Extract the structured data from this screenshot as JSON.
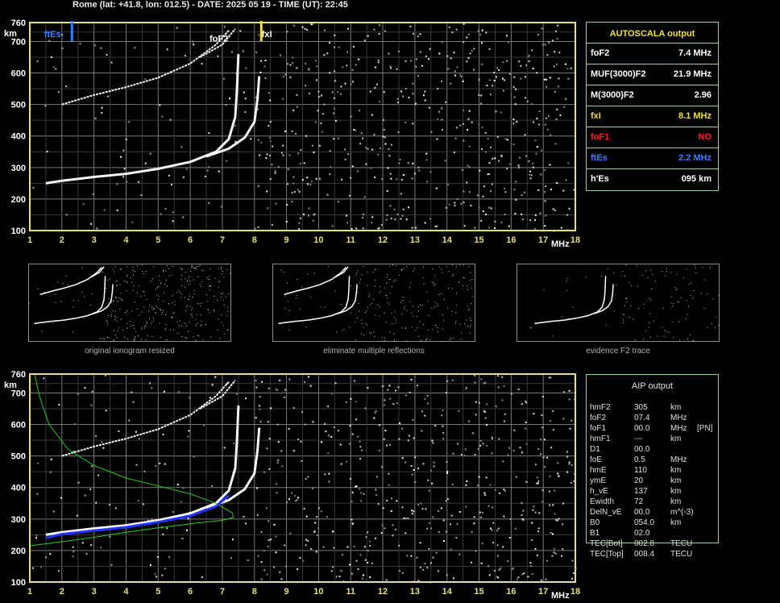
{
  "header": {
    "title": "Rome (lat: +41.8, lon: 012.5) - DATE: 2025 05 19 - TIME (UT): 22:45"
  },
  "colors": {
    "axis": "#e8e07a",
    "grid": "#7a7a7a",
    "panel_border": "#8fd68f",
    "ftes": "#3a7fff",
    "fxi": "#f0e040",
    "fof1": "#ff2020",
    "profile_green": "#22cc22",
    "profile_blue": "#2233ff"
  },
  "chart_data": [
    {
      "type": "scatter",
      "name_id": "main-ionogram",
      "xlabel": "MHz",
      "ylabel": "km",
      "xlim": [
        1,
        18
      ],
      "ylim": [
        100,
        760
      ],
      "x_ticks": [
        "1",
        "2",
        "3",
        "4",
        "5",
        "6",
        "7",
        "8",
        "9",
        "10",
        "11",
        "12",
        "13",
        "14",
        "15",
        "16",
        "17",
        "18"
      ],
      "y_ticks": [
        "100",
        "200",
        "300",
        "400",
        "500",
        "600",
        "700",
        "760"
      ],
      "grid": true,
      "markers": [
        {
          "label": "ftEs",
          "x": 2.2,
          "color": "#3a7fff"
        },
        {
          "label": "fxI",
          "x": 8.1,
          "color": "#f0e040"
        }
      ],
      "annotations": [
        {
          "label": "foF2",
          "x": 6.6,
          "y": 710
        }
      ],
      "traces": {
        "o_first_hop": [
          [
            1.5,
            250
          ],
          [
            2,
            258
          ],
          [
            3,
            270
          ],
          [
            4,
            280
          ],
          [
            5,
            296
          ],
          [
            6,
            318
          ],
          [
            6.8,
            350
          ],
          [
            7.2,
            390
          ],
          [
            7.4,
            460
          ],
          [
            7.45,
            540
          ],
          [
            7.5,
            660
          ]
        ],
        "x_first_hop": [
          [
            6.5,
            335
          ],
          [
            7.2,
            360
          ],
          [
            7.7,
            395
          ],
          [
            8.0,
            445
          ],
          [
            8.1,
            520
          ],
          [
            8.15,
            590
          ]
        ],
        "o_second_hop": [
          [
            2,
            500
          ],
          [
            3,
            530
          ],
          [
            4,
            555
          ],
          [
            5,
            585
          ],
          [
            6,
            630
          ],
          [
            6.8,
            690
          ],
          [
            7.2,
            735
          ]
        ],
        "x_second_hop": [
          [
            6.3,
            650
          ],
          [
            7.0,
            690
          ],
          [
            7.4,
            740
          ]
        ]
      }
    },
    {
      "type": "scatter",
      "name_id": "aip-ionogram",
      "xlabel": "MHz",
      "ylabel": "km",
      "xlim": [
        1,
        18
      ],
      "ylim": [
        100,
        760
      ],
      "x_ticks": [
        "1",
        "2",
        "3",
        "4",
        "5",
        "6",
        "7",
        "8",
        "9",
        "10",
        "11",
        "12",
        "13",
        "14",
        "15",
        "16",
        "17",
        "18"
      ],
      "y_ticks": [
        "100",
        "200",
        "300",
        "400",
        "500",
        "600",
        "700",
        "760"
      ],
      "grid": true,
      "profile_green": [
        [
          1.15,
          760
        ],
        [
          1.3,
          690
        ],
        [
          1.6,
          600
        ],
        [
          2.2,
          520
        ],
        [
          3,
          470
        ],
        [
          4,
          430
        ],
        [
          5,
          405
        ],
        [
          6,
          380
        ],
        [
          6.8,
          350
        ],
        [
          7.3,
          320
        ],
        [
          7.35,
          305
        ],
        [
          7.0,
          296
        ],
        [
          6,
          285
        ],
        [
          5,
          272
        ],
        [
          4,
          258
        ],
        [
          3,
          242
        ],
        [
          2,
          228
        ],
        [
          1,
          215
        ]
      ],
      "profile_blue": [
        [
          1.5,
          240
        ],
        [
          2,
          252
        ],
        [
          3,
          263
        ],
        [
          4,
          274
        ],
        [
          5,
          290
        ],
        [
          6,
          310
        ],
        [
          6.8,
          340
        ],
        [
          7.2,
          375
        ]
      ]
    }
  ],
  "autoscala": {
    "title": "AUTOSCALA output",
    "rows": [
      {
        "label": "foF2",
        "value": "7.4 MHz",
        "color": "#ffffff"
      },
      {
        "label": "MUF(3000)F2",
        "value": "21.9 MHz",
        "color": "#ffffff"
      },
      {
        "label": "M(3000)F2",
        "value": "2.96",
        "color": "#ffffff"
      },
      {
        "label": "fxI",
        "value": "8.1 MHz",
        "color": "#f0e040"
      },
      {
        "label": "foF1",
        "value": "NO",
        "color": "#ff2020"
      },
      {
        "label": "ftEs",
        "value": "2.2 MHz",
        "color": "#3a7fff"
      },
      {
        "label": "h'Es",
        "value": "095    km",
        "color": "#ffffff"
      }
    ]
  },
  "aip": {
    "title": "AIP output",
    "rows": [
      {
        "label": "hmF2",
        "value": "305",
        "unit": "km",
        "extra": ""
      },
      {
        "label": "foF2",
        "value": "07.4",
        "unit": "MHz",
        "extra": ""
      },
      {
        "label": "foF1",
        "value": "00.0",
        "unit": "MHz",
        "extra": "[PN]"
      },
      {
        "label": "hmF1",
        "value": "---",
        "unit": "km",
        "extra": ""
      },
      {
        "label": "D1",
        "value": "00.0",
        "unit": "",
        "extra": ""
      },
      {
        "label": "foE",
        "value": "0.5",
        "unit": "MHz",
        "extra": ""
      },
      {
        "label": "hmE",
        "value": "110",
        "unit": "km",
        "extra": ""
      },
      {
        "label": "ymE",
        "value": "20",
        "unit": "km",
        "extra": ""
      },
      {
        "label": "h_vE",
        "value": "137",
        "unit": "km",
        "extra": ""
      },
      {
        "label": "Ewidth",
        "value": "72",
        "unit": "km",
        "extra": ""
      },
      {
        "label": "DelN_vE",
        "value": "00.0",
        "unit": "m^(-3)",
        "extra": ""
      },
      {
        "label": "B0",
        "value": "054.0",
        "unit": "km",
        "extra": ""
      },
      {
        "label": "B1",
        "value": "02.0",
        "unit": "",
        "extra": ""
      },
      {
        "label": "TEC[Bot]",
        "value": "002.8",
        "unit": "TECU",
        "extra": ""
      },
      {
        "label": "TEC[Top]",
        "value": "008.4",
        "unit": "TECU",
        "extra": ""
      }
    ]
  },
  "thumbnails": [
    {
      "caption": "original ionogram resized"
    },
    {
      "caption": "eliminate multiple reflections"
    },
    {
      "caption": "evidence F2 trace"
    }
  ]
}
